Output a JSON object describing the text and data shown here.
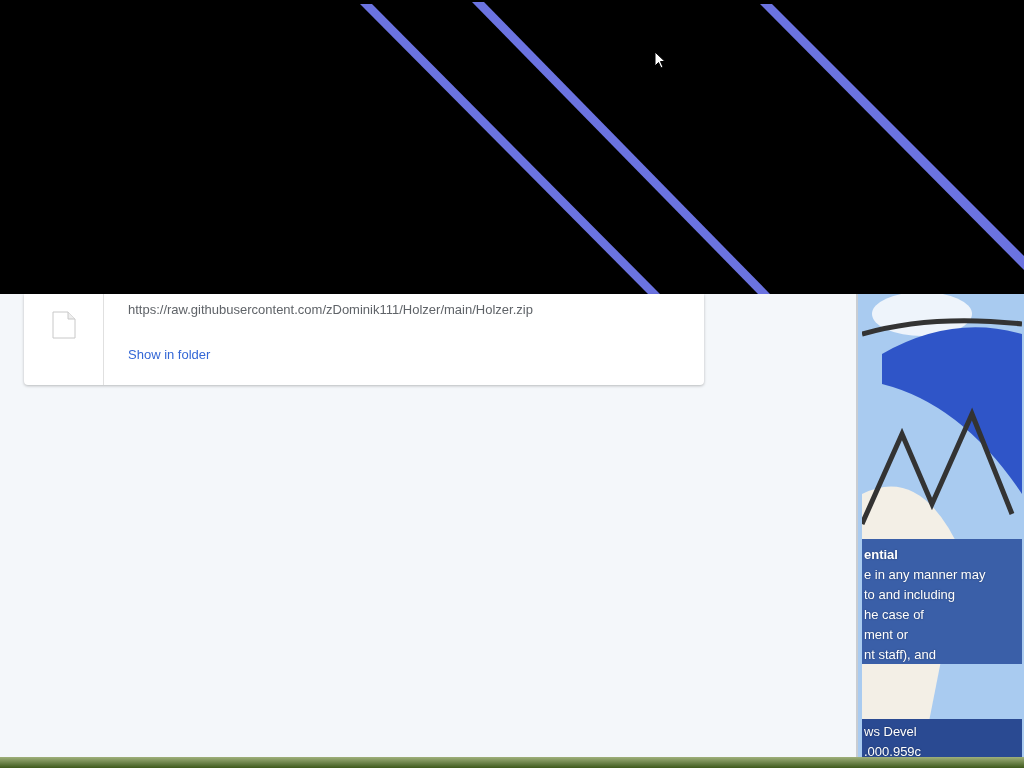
{
  "download": {
    "url": "https://raw.githubusercontent.com/zDominik111/Holzer/main/Holzer.zip",
    "action": "Show in folder"
  },
  "desktop_text": [
    {
      "text": "ential",
      "bold": true
    },
    {
      "text": "e in any manner may",
      "bold": false
    },
    {
      "text": "to and including",
      "bold": false
    },
    {
      "text": "he case of",
      "bold": false
    },
    {
      "text": "ment or",
      "bold": false
    },
    {
      "text": "nt staff), and",
      "bold": false
    }
  ],
  "build_text": [
    "ws Devel",
    ".000.959c"
  ]
}
